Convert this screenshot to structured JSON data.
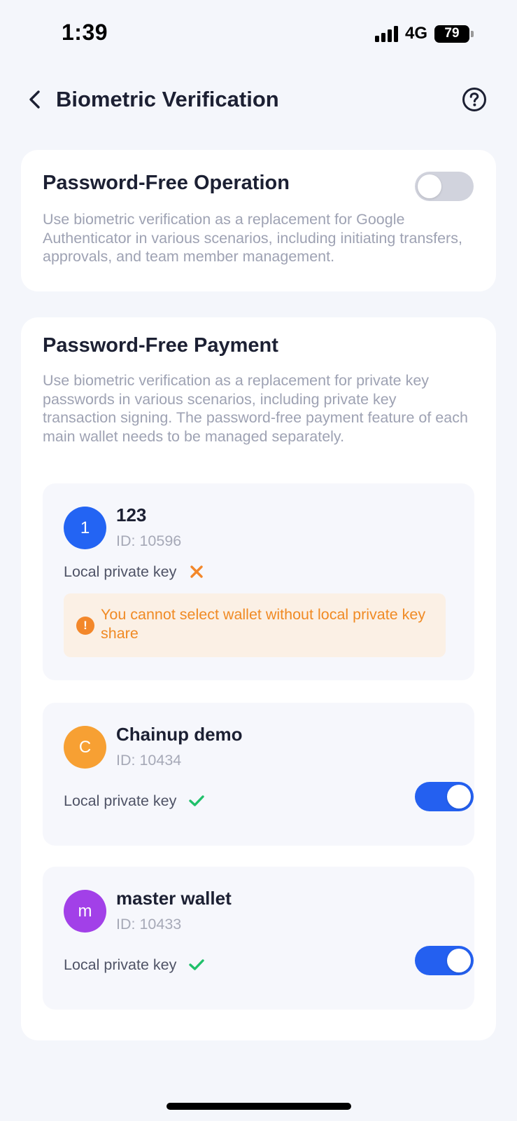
{
  "status_bar": {
    "time": "1:39",
    "network": "4G",
    "battery": "79"
  },
  "header": {
    "title": "Biometric Verification"
  },
  "password_free_operation": {
    "title": "Password-Free Operation",
    "description": "Use biometric verification as a replacement for Google Authenticator in various scenarios, including initiating transfers, approvals, and team member management.",
    "enabled": false
  },
  "password_free_payment": {
    "title": "Password-Free Payment",
    "description": "Use biometric verification as a replacement for private key passwords in various scenarios, including private key transaction signing. The password-free payment feature of each main wallet needs to be managed separately.",
    "wallets": [
      {
        "avatar_letter": "1",
        "avatar_color": "#2364f3",
        "name": "123",
        "id": "ID: 10596",
        "key_label": "Local private key",
        "has_local_key": false,
        "key_icon": "cross-icon",
        "warning": "You cannot select wallet without local private key share"
      },
      {
        "avatar_letter": "C",
        "avatar_color": "#f7a033",
        "name": "Chainup demo",
        "id": "ID: 10434",
        "key_label": "Local private key",
        "has_local_key": true,
        "key_icon": "check-icon",
        "enabled": true
      },
      {
        "avatar_letter": "m",
        "avatar_color": "#a240e8",
        "name": "master wallet",
        "id": "ID: 10433",
        "key_label": "Local private key",
        "has_local_key": true,
        "key_icon": "check-icon",
        "enabled": true
      }
    ]
  },
  "colors": {
    "accent": "#2460f0",
    "warning": "#f08a24",
    "success": "#20c06a",
    "background": "#f4f6fb"
  }
}
